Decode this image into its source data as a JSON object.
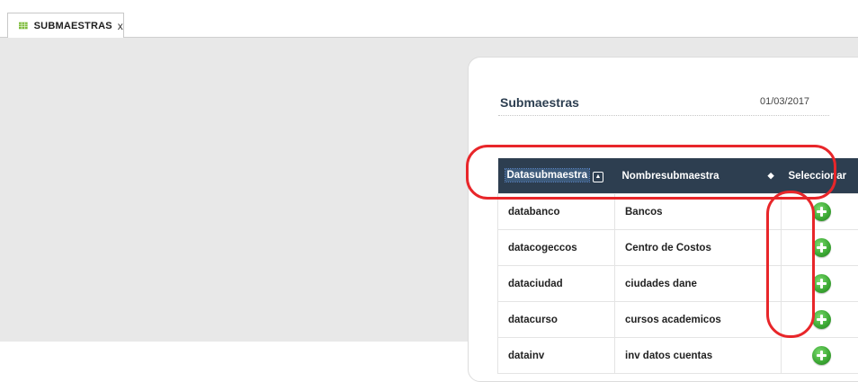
{
  "tab": {
    "label": "SUBMAESTRAS",
    "close": "x",
    "icon": "grid-icon"
  },
  "panel": {
    "title": "Submaestras",
    "date": "01/03/2017"
  },
  "table": {
    "headers": [
      "Datasubmaestra",
      "Nombresubmaestra",
      "Seleccionar"
    ],
    "rows": [
      [
        "databanco",
        "Bancos"
      ],
      [
        "datacogeccos",
        "Centro de Costos"
      ],
      [
        "dataciudad",
        "ciudades dane"
      ],
      [
        "datacurso",
        "cursos academicos"
      ],
      [
        "datainv",
        "inv datos cuentas"
      ]
    ]
  },
  "colors": {
    "header_bg": "#2d3e50",
    "annotation": "#e8262a",
    "add_button": "#3aa632"
  }
}
